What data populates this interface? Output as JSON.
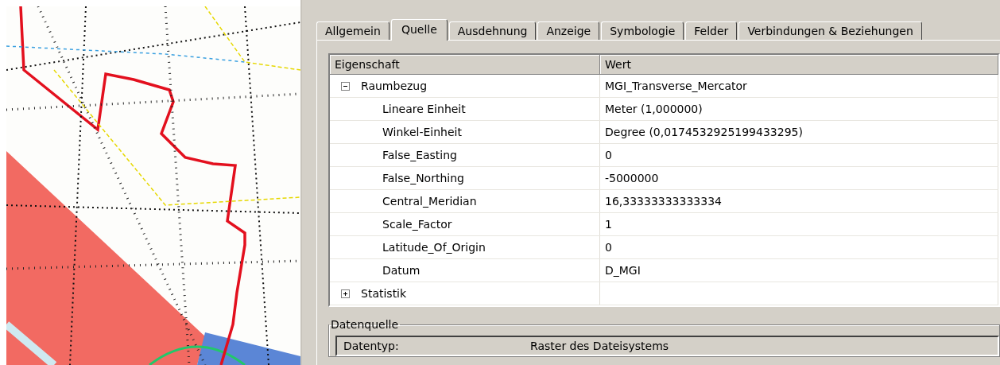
{
  "tabs": [
    {
      "label": "Allgemein",
      "selected": false
    },
    {
      "label": "Quelle",
      "selected": true
    },
    {
      "label": "Ausdehnung",
      "selected": false
    },
    {
      "label": "Anzeige",
      "selected": false
    },
    {
      "label": "Symbologie",
      "selected": false
    },
    {
      "label": "Felder",
      "selected": false
    },
    {
      "label": "Verbindungen & Beziehungen",
      "selected": false
    }
  ],
  "table": {
    "columns": [
      "Eigenschaft",
      "Wert"
    ],
    "rows": [
      {
        "property": "Raumbezug",
        "value": "MGI_Transverse_Mercator",
        "expanded": true,
        "children": [
          {
            "property": "Lineare Einheit",
            "value": "Meter (1,000000)"
          },
          {
            "property": "Winkel-Einheit",
            "value": "Degree (0,0174532925199433295)"
          },
          {
            "property": "False_Easting",
            "value": "0"
          },
          {
            "property": "False_Northing",
            "value": "-5000000"
          },
          {
            "property": "Central_Meridian",
            "value": "16,33333333333334"
          },
          {
            "property": "Scale_Factor",
            "value": "1"
          },
          {
            "property": "Latitude_Of_Origin",
            "value": "0"
          },
          {
            "property": "Datum",
            "value": "D_MGI"
          }
        ]
      },
      {
        "property": "Statistik",
        "value": "",
        "expanded": false,
        "children": []
      }
    ]
  },
  "datasource": {
    "title": "Datenquelle",
    "rows": [
      {
        "label": "Datentyp:",
        "value": "Raster des Dateisystems"
      }
    ]
  }
}
